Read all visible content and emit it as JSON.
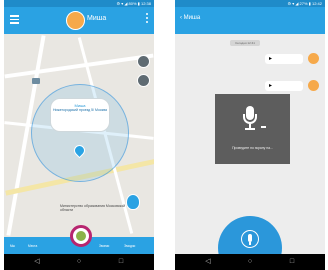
{
  "left": {
    "status": "⚙ ▾ ◢ 80% ▮ 12:38",
    "title": "Миша",
    "map_bubble": {
      "name": "Миша",
      "address": "Нижегородский проезд 5/ Москва"
    },
    "map_label": "Министерство образования Московской области",
    "bottom": {
      "item1": "Мы",
      "item2": "Места",
      "item3": "Звонки",
      "item4": "Эмодзи"
    }
  },
  "right": {
    "status": "⚙ ▾ ◢ 27% ▮ 12:42",
    "back_label": "Миша",
    "date_chip": "Сегодня 12:41",
    "record_hint": "Проведите по экрану на...",
    "record_button": "Удерживайте для записи"
  },
  "colors": {
    "appbar": "#2aa2e3",
    "statusbar": "#1f8bc9",
    "accent_ring": "#b7256f"
  }
}
